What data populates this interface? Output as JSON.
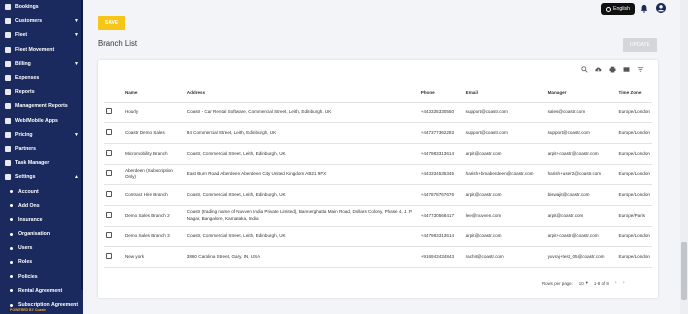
{
  "sidebar": {
    "items": [
      {
        "label": "Bookings",
        "icon": "bookings-icon",
        "chevron": false
      },
      {
        "label": "Customers",
        "icon": "customers-icon",
        "chevron": true
      },
      {
        "label": "Fleet",
        "icon": "fleet-icon",
        "chevron": true
      },
      {
        "label": "Fleet Movement",
        "icon": "fleet-movement-icon",
        "chevron": false
      },
      {
        "label": "Billing",
        "icon": "billing-icon",
        "chevron": true
      },
      {
        "label": "Expenses",
        "icon": "expenses-icon",
        "chevron": false
      },
      {
        "label": "Reports",
        "icon": "reports-icon",
        "chevron": false
      },
      {
        "label": "Management Reports",
        "icon": "management-reports-icon",
        "chevron": false
      },
      {
        "label": "Web/Mobile Apps",
        "icon": "apps-icon",
        "chevron": false
      },
      {
        "label": "Pricing",
        "icon": "pricing-icon",
        "chevron": true
      },
      {
        "label": "Partners",
        "icon": "partners-icon",
        "chevron": false
      },
      {
        "label": "Task Manager",
        "icon": "task-manager-icon",
        "chevron": false
      },
      {
        "label": "Settings",
        "icon": "settings-icon",
        "chevron": true
      }
    ],
    "settings_sub": [
      "Account",
      "Add Ons",
      "Insurance",
      "Organisation",
      "Users",
      "Roles",
      "Policies",
      "Rental Agreement",
      "Subscription Agreement"
    ],
    "footer": "POWERED BY Coastr"
  },
  "topbar": {
    "language": "English",
    "bell_icon": "bell-icon",
    "avatar_icon": "account-circle-icon"
  },
  "save_label": "SAVE",
  "page_title": "Branch List",
  "update_label": "UPDATE",
  "toolbar_icons": [
    "search-icon",
    "download-icon",
    "print-icon",
    "view-columns-icon",
    "filter-icon"
  ],
  "table": {
    "headers": [
      "Name",
      "Address",
      "Phone",
      "Email",
      "Manager",
      "Time Zone"
    ],
    "rows": [
      [
        "Hourly",
        "Coastr - Car Rental Software, Commercial Street, Leith, Edinburgh, UK",
        "+443335330550",
        "support@coastr.com",
        "sales@coastr.com",
        "Europe/London"
      ],
      [
        "Coastr Demo Sales",
        "84 Commercial Street, Leith, Edinburgh, UK",
        "+447377362283",
        "support@coastr.com",
        "support@coastr.com",
        "Europe/London"
      ],
      [
        "Micromobility Branch",
        "Coastr, Commercial Street, Leith, Edinburgh, UK",
        "+447983313614",
        "arpit@coastr.com",
        "arpit+coastr@coastr.com",
        "Europe/London"
      ],
      [
        "Aberdeen (Subscription Only)",
        "East Burn Road Aberdeen Aberdeen City United Kingdom AB21 9FX",
        "+443334535345",
        "harish+bmaberdeen@coastr.com",
        "harish+user2@coastr.com",
        "Europe/London"
      ],
      [
        "Contract Hire Branch",
        "Coastr, Commercial Street, Leith, Edinburgh, UK",
        "+447878767676",
        "arpit@coastr.com",
        "biswajit@coastr.com",
        "Europe/London"
      ],
      [
        "Demo Sales Branch 2",
        "Coastr (trading name of Nuvven India Private Limited), Bannerghatta Main Road, Dollars Colony, Phase 4, J. P. Nagar, Bangalore, Karnataka, India",
        "+447730568417",
        "lee@nuvven.com",
        "arpit@coastr.com",
        "Europe/Paris"
      ],
      [
        "Demo Sales Branch 3",
        "Coastr, Commercial Street, Leith, Edinburgh, UK",
        "+447983313614",
        "arpit@coastr.com",
        "arpit+coastr@coastr.com",
        "Europe/London"
      ],
      [
        "New york",
        "3860 Carolina Street, Gary, IN, USA",
        "+916943434843",
        "rachit@coastr.com",
        "yuvraj+test_05@coastr.com",
        "Europe/London"
      ]
    ]
  },
  "pagination": {
    "rows_per_page_label": "Rows per page:",
    "rows_per_page_value": "10",
    "range": "1-8 of 8"
  },
  "colors": {
    "sidebar_bg": "#1b2a5e",
    "save_button": "#f5c518",
    "update_button_disabled": "#d4d6da"
  }
}
